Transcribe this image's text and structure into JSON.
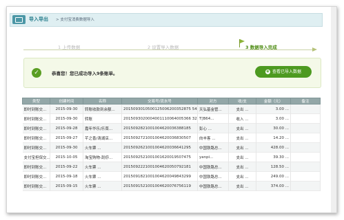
{
  "header": {
    "title": "导入导出",
    "breadcrumb": "> 支付宝消费数据导入"
  },
  "steps": [
    {
      "label": "1 上传数据"
    },
    {
      "label": "2 设置导入数据"
    },
    {
      "label": "3 数据导入完成"
    }
  ],
  "result": {
    "message": "恭喜您！您已成功导入9条账单。",
    "button": "查看已导入数据",
    "button_icon": "eye-icon"
  },
  "table": {
    "columns": [
      "类型",
      "创建时间",
      "名称",
      "交易号/流水号",
      "对方",
      "收/支",
      "金额（元）",
      "备注"
    ],
    "rows": [
      [
        "即时到账交...",
        "2015-09-30",
        "转账收款到余额...",
        "2015093010500125006200352875 54...",
        "天弘基金管...",
        "支出 ...",
        "3.00 ...",
        ""
      ],
      [
        "即时到账交...",
        "2015-09-30",
        "转账",
        "2015093020004001110064005366 327...",
        "T[B64...",
        "收入 ...",
        "3.00 ...",
        ""
      ],
      [
        "即时到账交...",
        "2015-09-28",
        "嘉年华乐/乐菜...",
        "2015092821001004620036388185",
        "彭心 ...",
        "支出 ...",
        "30.00 ...",
        ""
      ],
      [
        "即时到账交...",
        "2015-09-27",
        "芊之香/清湖店...",
        "2015092721001004620036830507",
        "向丰客 ...",
        "支出 ...",
        "14.20 ...",
        ""
      ],
      [
        "即时到账交...",
        "2015-09-30",
        "火车票 ...",
        "2015092621001004620036641295",
        "中国铁路总...",
        "支出 ...",
        "428.00 ...",
        ""
      ],
      [
        "支付宝担保交...",
        "2015-10-05",
        "淘宝购物-刮痧...",
        "2015092521001001620019507475",
        "yanpi...",
        "支出 ...",
        "39.30 ...",
        ""
      ],
      [
        "即时到账交...",
        "2015-09-22",
        "火车票 ...",
        "2015092221001004620050792181",
        "中国铁路总...",
        "支出 ...",
        "128.50 ...",
        ""
      ],
      [
        "即时到账交...",
        "2015-09-18",
        "火车票 ...",
        "2015091821001004620049843299",
        "中国铁路总...",
        "支出 ...",
        "249.00 ...",
        ""
      ],
      [
        "即时到账交...",
        "2015-09-15",
        "火车票 ...",
        "2015091521001004620076756119",
        "中国铁路总...",
        "支出 ...",
        "374.00 ...",
        ""
      ]
    ]
  }
}
